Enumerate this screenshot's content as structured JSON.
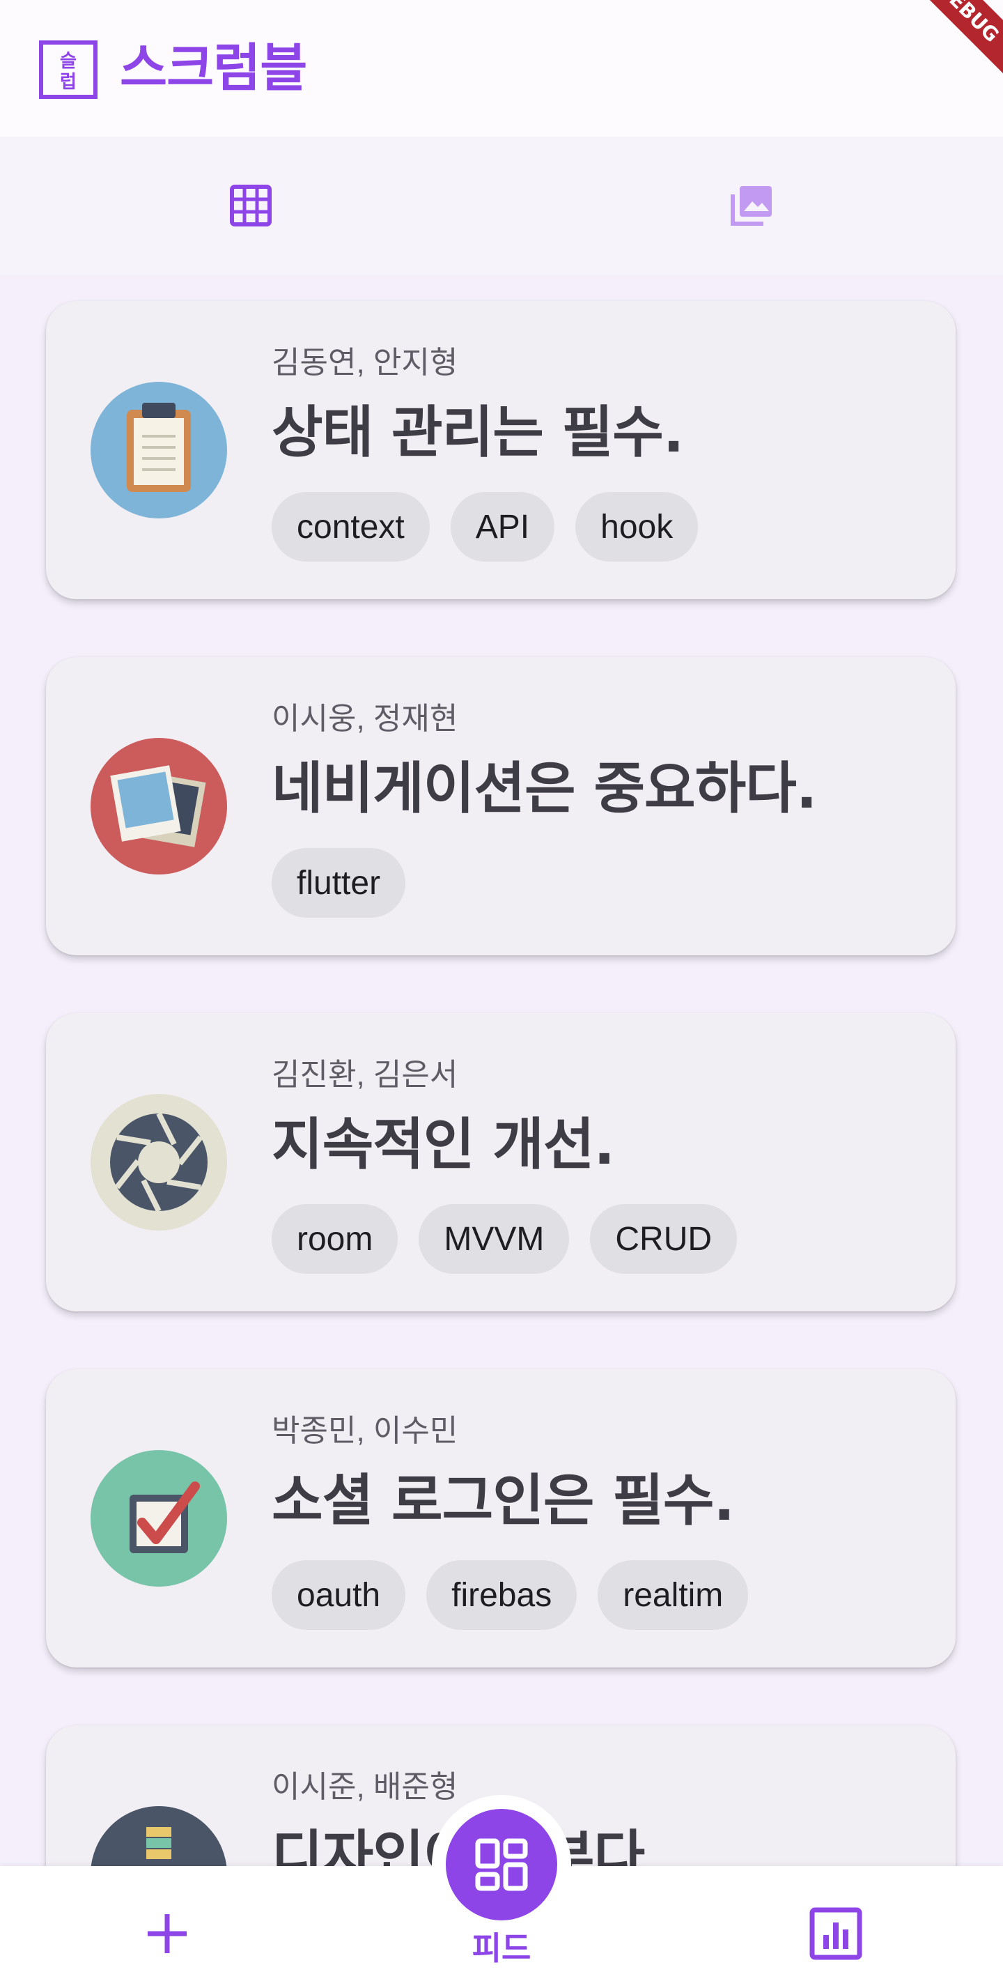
{
  "app": {
    "title": "스크럼블",
    "logo_icon": "scrumble-logo-icon",
    "debug_badge": "DEBUG",
    "accent": "#8d45e8"
  },
  "tabs": [
    {
      "icon": "grid-icon",
      "selected": true
    },
    {
      "icon": "photo-library-icon",
      "selected": false
    }
  ],
  "cards": [
    {
      "authors": "김동연, 안지형",
      "title": "상태 관리는 필수.",
      "icon": "clipboard-icon",
      "tags": [
        "context",
        "API",
        "hook"
      ]
    },
    {
      "authors": "이시웅, 정재현",
      "title": "네비게이션은 중요하다.",
      "icon": "photos-icon",
      "tags": [
        "flutter"
      ]
    },
    {
      "authors": "김진환, 김은서",
      "title": "지속적인 개선.",
      "icon": "aperture-icon",
      "tags": [
        "room",
        "MVVM",
        "CRUD"
      ]
    },
    {
      "authors": "박종민, 이수민",
      "title": "소셜 로그인은 필수.",
      "icon": "checkbox-icon",
      "tags": [
        "oauth",
        "firebas",
        "realtim"
      ]
    },
    {
      "authors": "이시준, 배준형",
      "title": "디자인이 전부다",
      "icon": "book-stack-icon",
      "tags": []
    }
  ],
  "bottom_nav": {
    "add_icon": "plus-icon",
    "feed_label": "피드",
    "feed_icon": "feed-icon",
    "stats_icon": "bar-chart-icon"
  }
}
